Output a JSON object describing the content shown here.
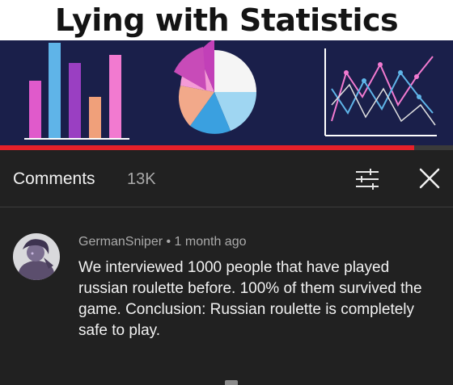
{
  "video": {
    "title": "Lying with Statistics",
    "progress_fraction": 0.915
  },
  "comments_panel": {
    "label": "Comments",
    "count": "13K",
    "icons": {
      "filter": "sort-filter-icon",
      "close": "close-icon"
    }
  },
  "comment": {
    "author": "GermanSniper",
    "separator": " • ",
    "time": "1 month ago",
    "text": "We interviewed 1000 people that have played russian roulette before. 100% of them survived the game. Conclusion: Russian roulette is completely safe to play."
  },
  "colors": {
    "background": "#212121",
    "text_primary": "#f1f1f1",
    "text_secondary": "#aaaaaa",
    "progress": "#e6202a",
    "thumbnail_bg": "#1a1f4a"
  }
}
